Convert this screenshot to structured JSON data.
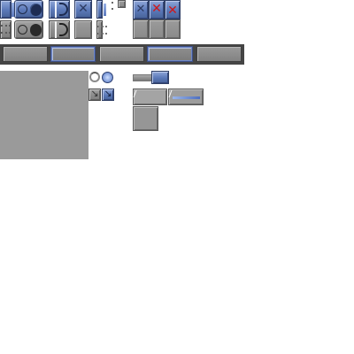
{
  "sprite": {
    "accent_blue": "#5a78b8",
    "panel_grey": "#9a9a9a",
    "close_red": "#d01818",
    "icons": {
      "close": "✕",
      "radio_ring": "○",
      "arrow": "↘"
    },
    "tabs": [
      "",
      "",
      "",
      "",
      ""
    ],
    "scroll_buttons": [
      "",
      ""
    ]
  }
}
